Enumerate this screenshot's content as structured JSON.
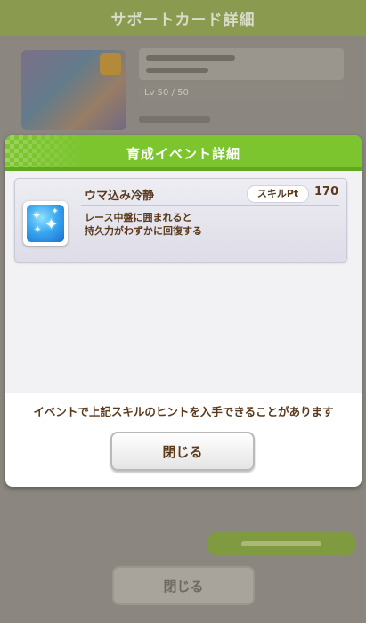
{
  "background": {
    "header_title": "サポートカード詳細",
    "level_text": "Lv 50 / 50",
    "close_label": "閉じる"
  },
  "modal": {
    "title": "育成イベント詳細",
    "skill": {
      "name": "ウマ込み冷静",
      "pt_label": "スキルPt",
      "pt_value": "170",
      "description_line1": "レース中盤に囲まれると",
      "description_line2": "持久力がわずかに回復する",
      "icon": "sparkle-skill-icon"
    },
    "hint": "イベントで上記スキルのヒントを入手できることがあります",
    "close_label": "閉じる"
  },
  "colors": {
    "header_green": "#7cc52e",
    "text_brown": "#5b3a1c",
    "skill_icon_blue": "#3aa8f0"
  }
}
